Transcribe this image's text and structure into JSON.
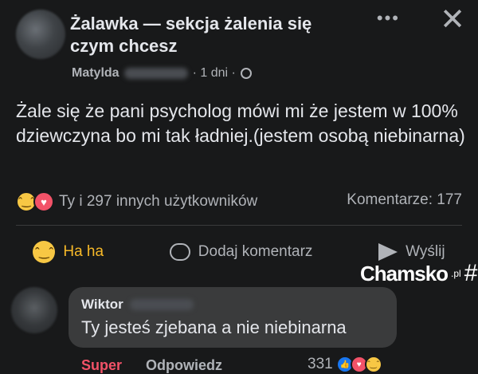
{
  "post": {
    "group_title": "Żalawka — sekcja żalenia się czym chcesz",
    "author": "Matylda",
    "time": "· 1 dni ·",
    "text": "Żale się że pani psycholog mówi mi że jestem w 100% dziewczyna bo mi tak ładniej.(jestem osobą niebinarna)",
    "reactions_label": "Ty i 297 innych użytkowników",
    "comments_label": "Komentarze: 177"
  },
  "actions": {
    "haha": "Ha ha",
    "comment": "Dodaj komentarz",
    "send": "Wyślij"
  },
  "watermark": {
    "text": "Chamsko",
    "suffix": ".pl",
    "hash": "#"
  },
  "comment": {
    "author": "Wiktor",
    "text": "Ty jesteś zjebana a nie niebinarna",
    "reaction_label": "Super",
    "reply_label": "Odpowiedz",
    "reaction_count": "331"
  },
  "icons": {
    "more": "more-dots-icon",
    "close": "close-icon",
    "globe": "globe-icon",
    "haha": "haha-icon",
    "comment": "comment-icon",
    "send": "send-icon"
  }
}
